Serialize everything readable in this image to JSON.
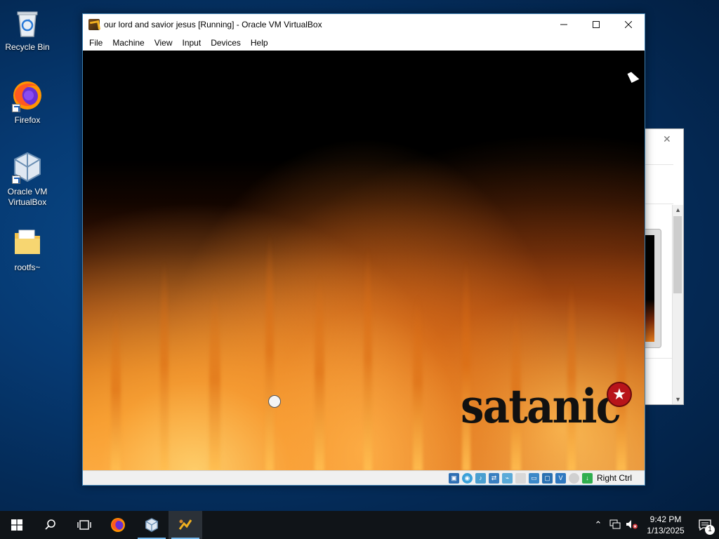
{
  "desktop": {
    "icons": [
      {
        "label": "Recycle Bin",
        "icon": "recycle-bin-icon"
      },
      {
        "label": "Firefox",
        "icon": "firefox-icon"
      },
      {
        "label": "Oracle VM VirtualBox",
        "icon": "virtualbox-icon"
      },
      {
        "label": "rootfs~",
        "icon": "folder-icon"
      }
    ]
  },
  "vbox": {
    "title": "our lord and savior jesus [Running] - Oracle VM VirtualBox",
    "menu": [
      "File",
      "Machine",
      "View",
      "Input",
      "Devices",
      "Help"
    ],
    "guest_logo_text": "satanic",
    "status_host_key": "Right Ctrl",
    "accent": "#3c7fb1"
  },
  "taskbar": {
    "time": "9:42 PM",
    "date": "1/13/2025",
    "notification_count": "1"
  }
}
